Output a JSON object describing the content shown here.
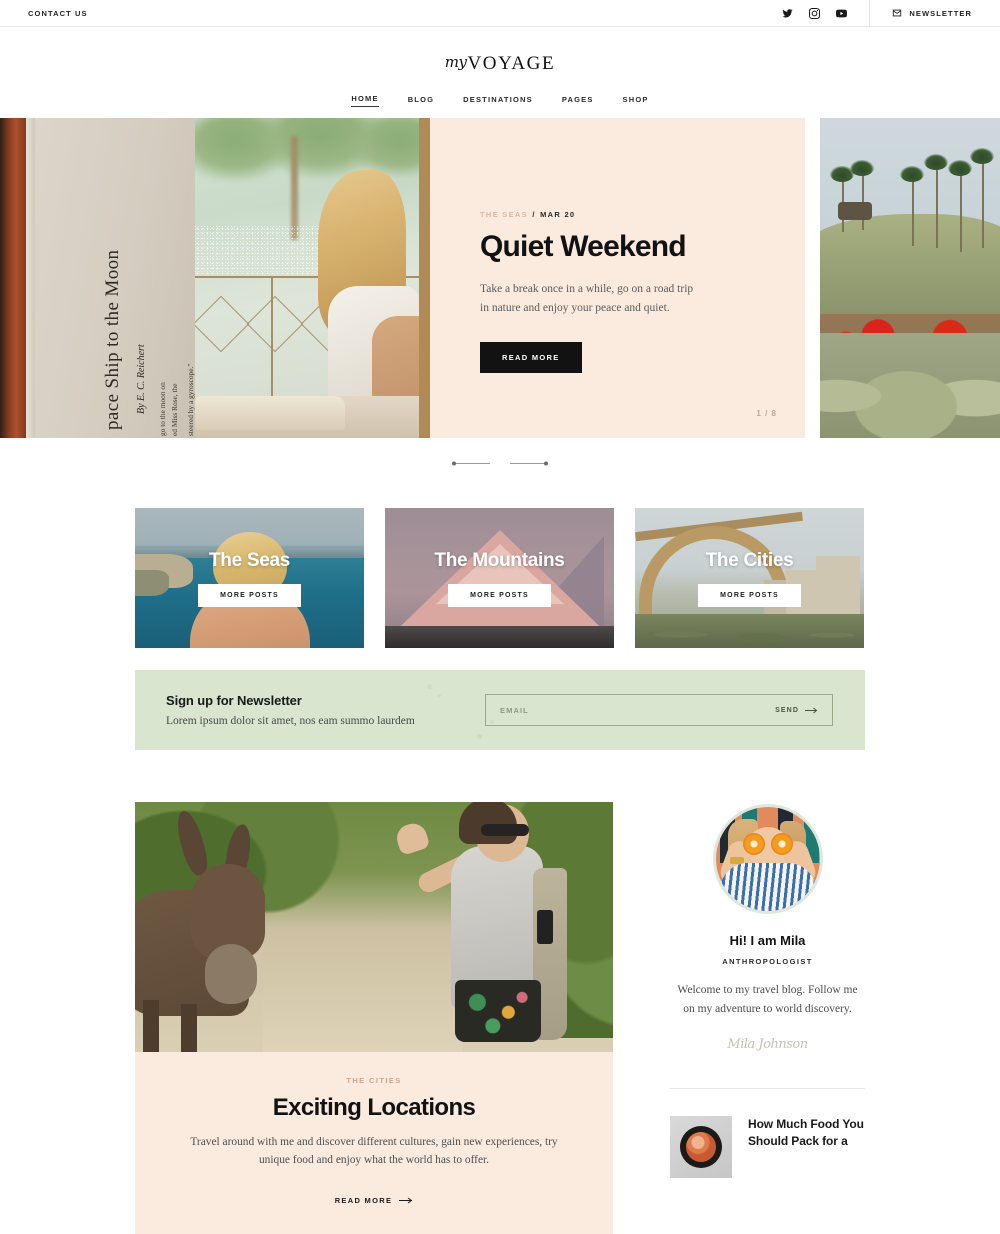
{
  "topbar": {
    "contact_label": "CONTACT US",
    "social": [
      {
        "name": "twitter-icon",
        "label": "Twitter"
      },
      {
        "name": "instagram-icon",
        "label": "Instagram"
      },
      {
        "name": "youtube-icon",
        "label": "YouTube"
      }
    ],
    "newsletter_label": "NEWSLETTER"
  },
  "header": {
    "logo_script": "my",
    "logo_main": "VOYAGE"
  },
  "nav": {
    "items": [
      {
        "label": "HOME",
        "active": true
      },
      {
        "label": "BLOG",
        "active": false
      },
      {
        "label": "DESTINATIONS",
        "active": false
      },
      {
        "label": "PAGES",
        "active": false
      },
      {
        "label": "SHOP",
        "active": false
      }
    ]
  },
  "hero": {
    "category": "THE SEAS",
    "separator": "/",
    "date": "MAR 20",
    "title": "Quiet Weekend",
    "excerpt": "Take a break once in a while, go on a road trip in nature and enjoy your peace and quiet.",
    "button_label": "READ MORE",
    "counter": "1 / 8",
    "prev_label": "Previous slide",
    "next_label": "Next slide",
    "left_slide_alt": "Open vintage book page reading Space Ship to the Moon",
    "right_slide_alt": "Palm trees and red bougainvillea on a hillside",
    "center_image_alt": "Woman with long blonde hair sitting at a rainy window"
  },
  "categories": [
    {
      "title": "The Seas",
      "button_label": "MORE POSTS"
    },
    {
      "title": "The Mountains",
      "button_label": "MORE POSTS"
    },
    {
      "title": "The Cities",
      "button_label": "MORE POSTS"
    }
  ],
  "newsletter": {
    "title": "Sign up for Newsletter",
    "subtitle": "Lorem ipsum dolor sit amet, nos eam summo laurdem",
    "input_placeholder": "EMAIL",
    "input_value": "",
    "send_label": "SEND"
  },
  "featured": {
    "image_alt": "Woman petting a donkey on a sunlit path",
    "category": "THE CITIES",
    "title": "Exciting Locations",
    "excerpt": "Travel around with me and discover different cultures, gain new experiences, try unique food and enjoy what the world has to offer.",
    "readmore_label": "READ MORE"
  },
  "sidebar": {
    "author": {
      "avatar_alt": "Mila holding orange halves over her eyes",
      "name": "Hi! I am Mila",
      "role": "ANTHROPOLOGIST",
      "bio": "Welcome to my travel blog. Follow me on my adventure to world discovery.",
      "signature": "Mila Johnson"
    },
    "posts": [
      {
        "thumb_alt": "Bowl of soup seen from above",
        "title": "How Much Food You Should Pack for a"
      }
    ]
  },
  "colors": {
    "hero_panel_bg": "#fbeade",
    "newsletter_bg": "#d9e5ce",
    "accent_rose": "#d9b9a6",
    "dark": "#121212",
    "white": "#ffffff"
  }
}
